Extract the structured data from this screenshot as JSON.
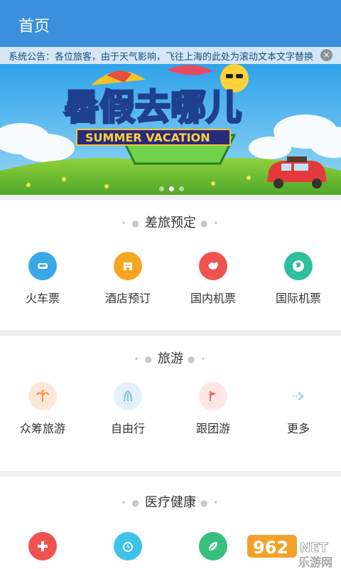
{
  "header": {
    "title": "首页"
  },
  "notice": {
    "text": "系统公告：各位旅客，由于天气影响，飞往上海的此处为滚动文本文字替换",
    "close_glyph": "×"
  },
  "banner": {
    "headline": "暑假去哪儿",
    "subtitle": "SUMMER VACATION",
    "slides": 3,
    "active_slide": 2
  },
  "sections": {
    "business": {
      "title": "差旅预定",
      "items": [
        {
          "label": "火车票",
          "icon": "train-icon",
          "color": "#3aa7e8"
        },
        {
          "label": "酒店预订",
          "icon": "hotel-icon",
          "color": "#f5a623"
        },
        {
          "label": "国内机票",
          "icon": "china-map-icon",
          "color": "#ef5350"
        },
        {
          "label": "国际机票",
          "icon": "globe-icon",
          "color": "#2dbf9e"
        }
      ]
    },
    "travel": {
      "title": "旅游",
      "items": [
        {
          "label": "众筹旅游",
          "icon": "palm-tree-icon",
          "color": "#fde8d7"
        },
        {
          "label": "自由行",
          "icon": "leaf-icon",
          "color": "#e2f1fb"
        },
        {
          "label": "跟团游",
          "icon": "group-flag-icon",
          "color": "#fde6e3"
        },
        {
          "label": "更多",
          "icon": "more-arrow-icon",
          "color": "#ffffff"
        }
      ]
    },
    "medical": {
      "title": "医疗健康",
      "items": [
        {
          "label": "",
          "icon": "medical-cross-icon",
          "color": "#ef5350"
        },
        {
          "label": "",
          "icon": "alarm-clock-icon",
          "color": "#3ec3e8"
        },
        {
          "label": "",
          "icon": "health-leaf-icon",
          "color": "#36c07c"
        }
      ]
    }
  },
  "watermark": {
    "logo_text": "962",
    "suffix": "NET",
    "sub": "乐游网"
  }
}
